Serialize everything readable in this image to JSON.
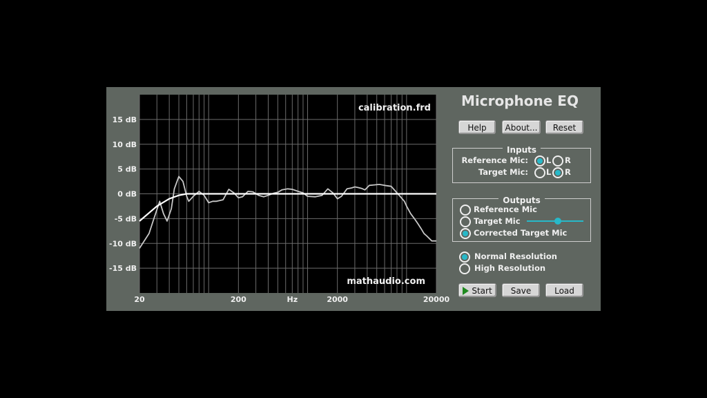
{
  "app": {
    "title": "Microphone EQ",
    "buttons": {
      "help": "Help",
      "about": "About...",
      "reset": "Reset",
      "start": "Start",
      "save": "Save",
      "load": "Load"
    },
    "inputs": {
      "title": "Inputs",
      "reference_label": "Reference Mic:",
      "target_label": "Target Mic:",
      "left": "L",
      "right": "R",
      "reference_selected": "L",
      "target_selected": "R"
    },
    "outputs": {
      "title": "Outputs",
      "options": [
        "Reference Mic",
        "Target Mic",
        "Corrected Target Mic"
      ],
      "selected": 2,
      "slider_value": 0.55
    },
    "resolution": {
      "options": [
        "Normal Resolution",
        "High Resolution"
      ],
      "selected": 0
    },
    "colors": {
      "accent": "#27b9c9",
      "panel": "#5f6660",
      "plot_bg": "#000000",
      "start_icon": "#1f8a1f"
    },
    "icons": {
      "start": "play-icon"
    }
  },
  "plot": {
    "file_label": "calibration.frd",
    "watermark": "mathaudio.com",
    "x_unit_label": "Hz",
    "x_tick_labels": [
      {
        "f": 20,
        "label": "20"
      },
      {
        "f": 200,
        "label": "200"
      },
      {
        "f": 2000,
        "label": "2000"
      },
      {
        "f": 20000,
        "label": "20000"
      }
    ],
    "y_tick_labels": [
      {
        "v": 15,
        "label": "15 dB"
      },
      {
        "v": 10,
        "label": "10 dB"
      },
      {
        "v": 5,
        "label": "5 dB"
      },
      {
        "v": 0,
        "label": "0 dB"
      },
      {
        "v": -5,
        "label": "-5 dB"
      },
      {
        "v": -10,
        "label": "-10 dB"
      },
      {
        "v": -15,
        "label": "-15 dB"
      }
    ]
  },
  "chart_data": {
    "type": "line",
    "xscale": "log",
    "xlim": [
      20,
      20000
    ],
    "ylim": [
      -20,
      20
    ],
    "grid": true,
    "series": [
      {
        "color": "#c8c8c8",
        "x": [
          20,
          25,
          28,
          32,
          35,
          38,
          42,
          45,
          50,
          55,
          60,
          63,
          70,
          80,
          90,
          100,
          110,
          120,
          140,
          160,
          180,
          200,
          220,
          250,
          280,
          320,
          360,
          400,
          450,
          500,
          550,
          630,
          700,
          800,
          900,
          1000,
          1200,
          1400,
          1600,
          1800,
          2000,
          2200,
          2500,
          2800,
          3000,
          3200,
          3500,
          3800,
          4200,
          4700,
          5300,
          6000,
          7000,
          8000,
          9500,
          10000,
          11000,
          12000,
          13000,
          14000,
          15000,
          16000,
          18000,
          20000
        ],
        "y": [
          -11,
          -8,
          -5,
          -1.5,
          -4,
          -5.5,
          -3,
          1,
          3.5,
          2.5,
          -0.5,
          -1.5,
          -0.5,
          0.5,
          -0.3,
          -1.8,
          -1.5,
          -1.5,
          -1.2,
          0.9,
          0.2,
          -0.8,
          -0.6,
          0.5,
          0.4,
          -0.3,
          -0.6,
          -0.3,
          0.1,
          0.3,
          0.8,
          1.0,
          0.9,
          0.5,
          0.2,
          -0.5,
          -0.6,
          -0.3,
          1.0,
          0.2,
          -1.0,
          -0.5,
          1.0,
          1.2,
          1.4,
          1.3,
          1.1,
          0.8,
          1.7,
          1.8,
          1.9,
          1.7,
          1.5,
          0.2,
          -1.5,
          -2.5,
          -4,
          -5,
          -6,
          -7,
          -8,
          -8.5,
          -9.5,
          -9.5
        ]
      },
      {
        "color": "#ffffff",
        "x": [
          20,
          30,
          40,
          50,
          60,
          80,
          100,
          1000,
          10000,
          20000
        ],
        "y": [
          -5.5,
          -2.5,
          -1.0,
          -0.3,
          0,
          0,
          0,
          0,
          0,
          0
        ]
      }
    ]
  }
}
